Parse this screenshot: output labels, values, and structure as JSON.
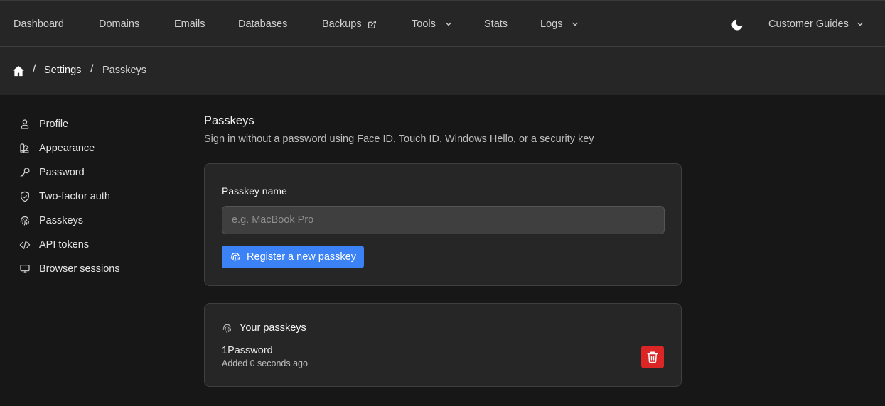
{
  "nav": {
    "items": [
      {
        "label": "Dashboard"
      },
      {
        "label": "Domains"
      },
      {
        "label": "Emails"
      },
      {
        "label": "Databases"
      },
      {
        "label": "Backups"
      },
      {
        "label": "Tools"
      },
      {
        "label": "Stats"
      },
      {
        "label": "Logs"
      }
    ],
    "guides_label": "Customer Guides"
  },
  "breadcrumb": {
    "items": [
      {
        "label": "Settings"
      },
      {
        "label": "Passkeys"
      }
    ],
    "separator": "/"
  },
  "sidebar": {
    "items": [
      {
        "label": "Profile"
      },
      {
        "label": "Appearance"
      },
      {
        "label": "Password"
      },
      {
        "label": "Two-factor auth"
      },
      {
        "label": "Passkeys"
      },
      {
        "label": "API tokens"
      },
      {
        "label": "Browser sessions"
      }
    ]
  },
  "main": {
    "title": "Passkeys",
    "subtitle": "Sign in without a password using Face ID, Touch ID, Windows Hello, or a security key",
    "form": {
      "label": "Passkey name",
      "placeholder": "e.g. MacBook Pro",
      "value": "",
      "register_label": "Register a new passkey"
    },
    "list": {
      "title": "Your passkeys",
      "items": [
        {
          "name": "1Password",
          "added": "Added 0 seconds ago"
        }
      ]
    }
  },
  "colors": {
    "primary": "#3b82f6",
    "danger": "#dc2626"
  }
}
